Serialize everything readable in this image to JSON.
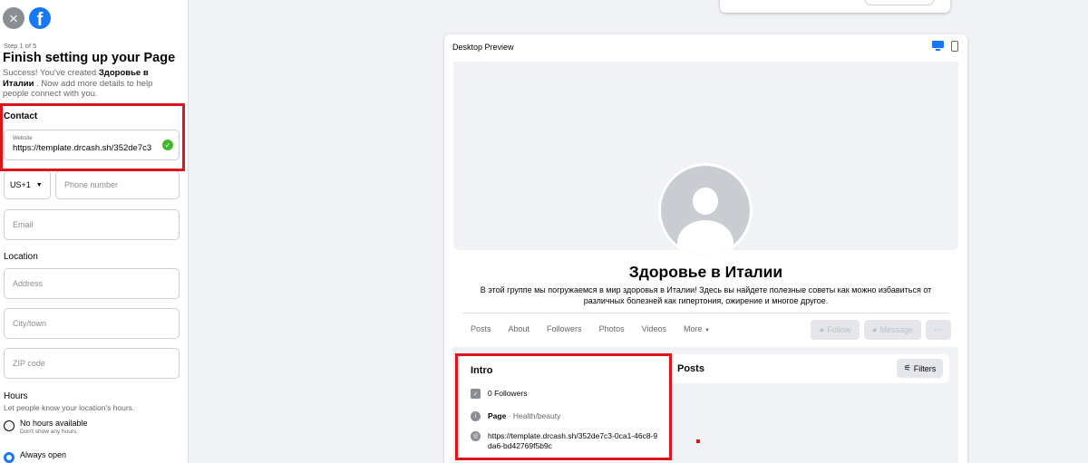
{
  "left_panel": {
    "step": "Step 1 of 5",
    "title": "Finish setting up your Page",
    "subtitle_prefix": "Success! You've created ",
    "subtitle_page_name": "Здоровье в Италии",
    "subtitle_suffix": " . Now add more details to help people connect with you.",
    "contact_label": "Contact",
    "website_caption": "Website",
    "website_value": "https://template.drcash.sh/352de7c3",
    "country_code": "US+1",
    "phone_placeholder": "Phone number",
    "email_placeholder": "Email",
    "location_label": "Location",
    "address_placeholder": "Address",
    "city_placeholder": "City/town",
    "zip_placeholder": "ZIP code",
    "hours_label": "Hours",
    "hours_sub": "Let people know your location's hours.",
    "hours_options": [
      {
        "label": "No hours available",
        "sub": "Don't show any hours.",
        "selected": false
      },
      {
        "label": "Always open",
        "sub": "",
        "selected": true
      }
    ]
  },
  "preview": {
    "title": "Desktop Preview",
    "page_name": "Здоровье в Италии",
    "description": "В этой группе мы погружаемся в мир здоровья в Италии! Здесь вы найдете полезные советы как можно избавиться от различных болезней как гипертония, ожирение и многое другое.",
    "tabs": [
      "Posts",
      "About",
      "Followers",
      "Photos",
      "Videos",
      "More"
    ],
    "follow_label": "Follow",
    "message_label": "Message",
    "more_actions": "···",
    "intro": {
      "title": "Intro",
      "followers": "0 Followers",
      "page_label": "Page",
      "page_type": " · Health/beauty",
      "website": "https://template.drcash.sh/352de7c3-0ca1-46c8-9da6-bd42769f5b9c"
    },
    "posts_title": "Posts",
    "filters_label": "Filters"
  },
  "icons": {
    "close": "close-icon",
    "logo": "facebook-logo-icon",
    "check": "check-circle-icon",
    "desktop": "desktop-icon",
    "mobile": "mobile-icon"
  },
  "colors": {
    "brand": "#1877f2",
    "highlight": "#e0121c",
    "success": "#42b72a"
  }
}
